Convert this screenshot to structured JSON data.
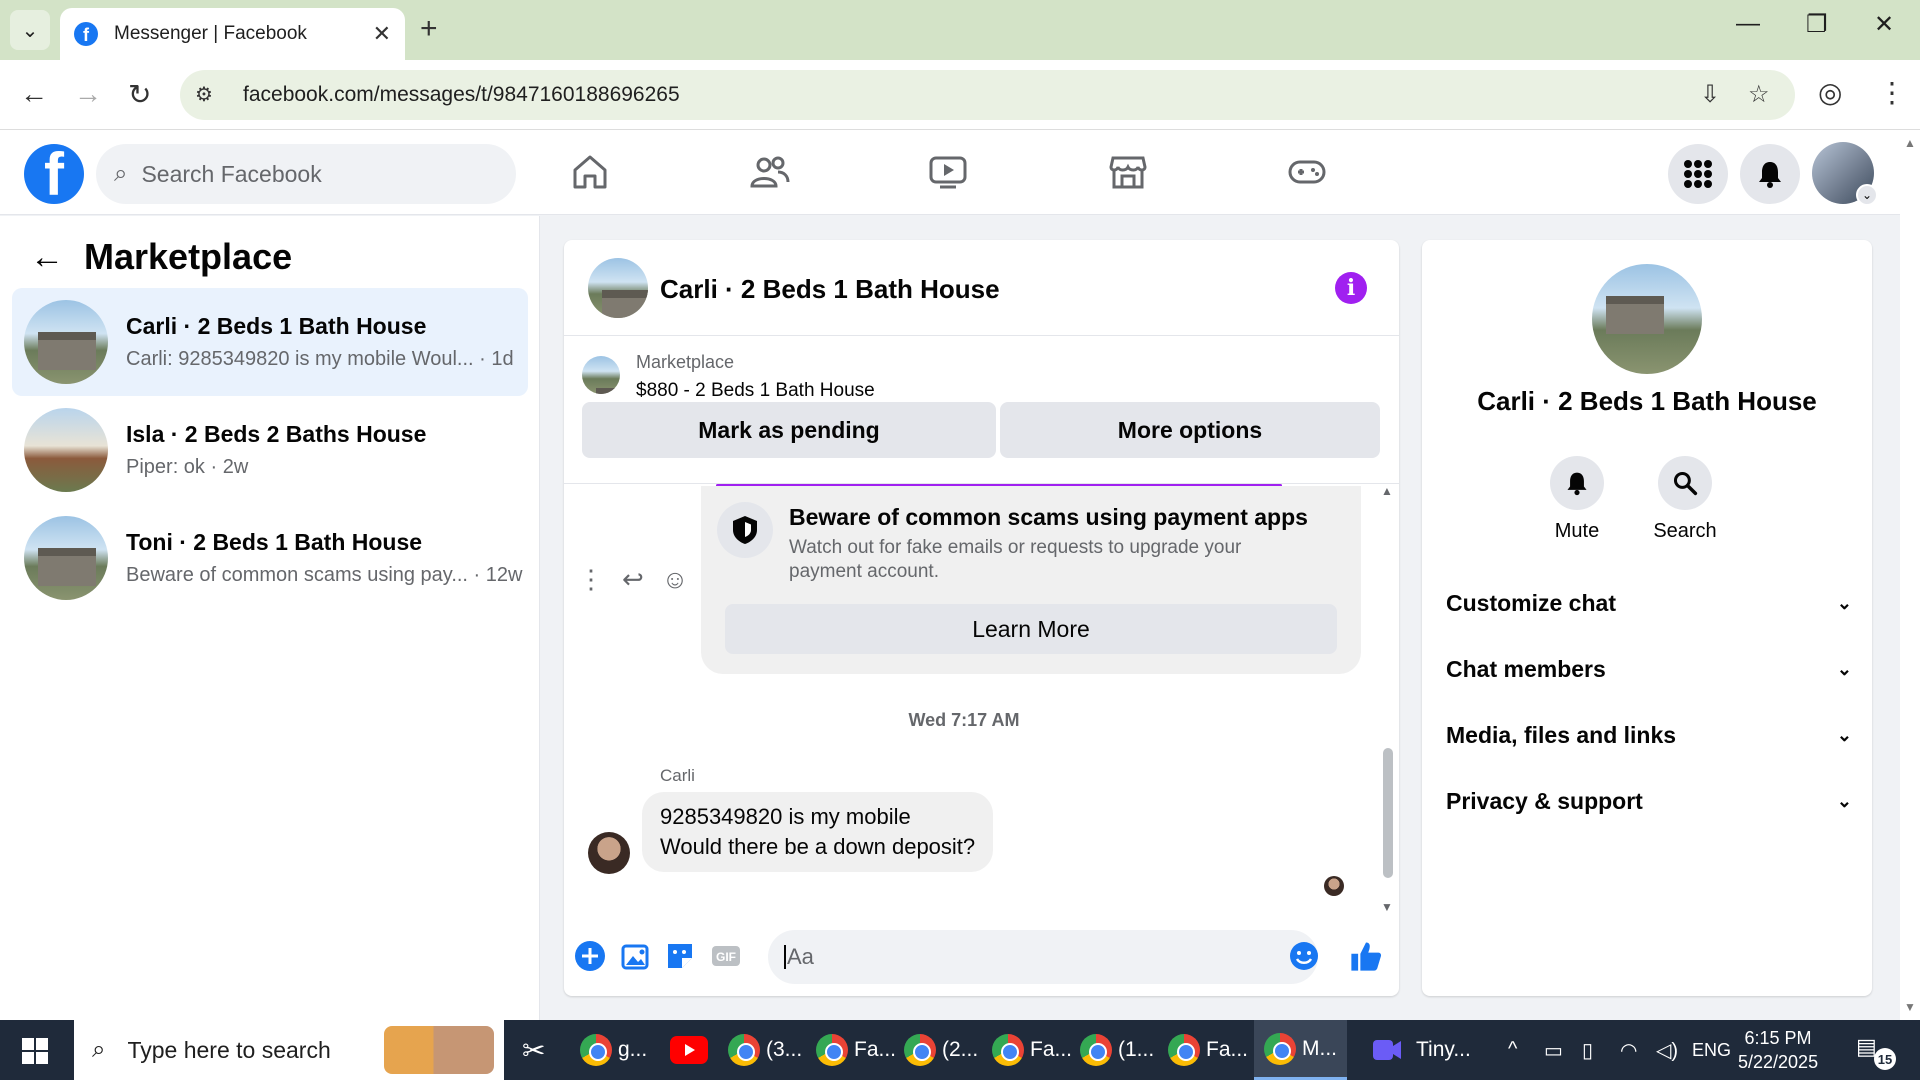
{
  "browser": {
    "tab_title": "Messenger | Facebook",
    "url": "facebook.com/messages/t/9847160188696265"
  },
  "fb": {
    "search_placeholder": "Search Facebook"
  },
  "left": {
    "title": "Marketplace",
    "conversations": [
      {
        "name": "Carli · 2 Beds 1 Bath House",
        "preview": "Carli: 9285349820 is my mobile Woul... · 1d"
      },
      {
        "name": "Isla · 2 Beds 2 Baths House",
        "preview": "Piper: ok · 2w"
      },
      {
        "name": "Toni · 2 Beds 1 Bath House",
        "preview": "Beware of common scams using pay... · 12w"
      }
    ]
  },
  "chat": {
    "header_name": "Carli · 2 Beds 1 Bath House",
    "listing_label": "Marketplace",
    "listing_price": "$880 - 2 Beds 1 Bath House",
    "mark_pending": "Mark as pending",
    "more_options": "More options",
    "scam_title": "Beware of common scams using payment apps",
    "scam_desc": "Watch out for fake emails or requests to upgrade your payment account.",
    "learn_more": "Learn More",
    "timestamp": "Wed 7:17 AM",
    "sender": "Carli",
    "message_line1": "9285349820 is my mobile",
    "message_line2": "Would there be a down deposit?",
    "composer_placeholder": "Aa"
  },
  "right": {
    "name": "Carli · 2 Beds 1 Bath House",
    "mute": "Mute",
    "search": "Search",
    "sections": [
      "Customize chat",
      "Chat members",
      "Media, files and links",
      "Privacy & support"
    ]
  },
  "taskbar": {
    "search_placeholder": "Type here to search",
    "apps": [
      "g...",
      "(3...",
      "Fa...",
      "(2...",
      "Fa...",
      "(1...",
      "Fa...",
      "M...",
      "Tiny..."
    ],
    "lang": "ENG",
    "time": "6:15 PM",
    "date": "5/22/2025",
    "notifications": "15"
  },
  "colors": {
    "fb_blue": "#1877f2",
    "info_purple": "#a020f0",
    "active_conv": "#e9f2fd"
  }
}
